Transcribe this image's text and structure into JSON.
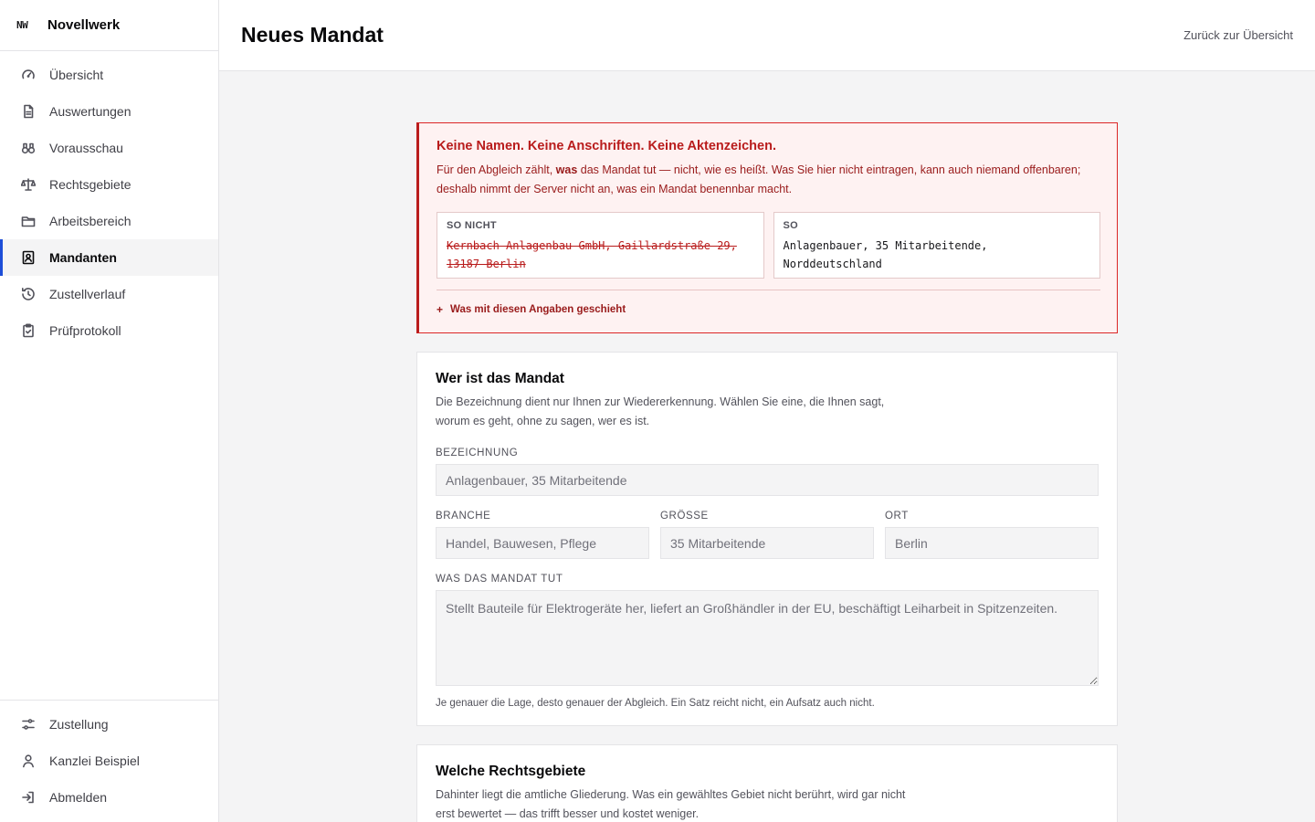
{
  "brand": {
    "mark": "NW",
    "name": "Novellwerk"
  },
  "nav": [
    {
      "label": "Übersicht",
      "icon": "gauge-icon"
    },
    {
      "label": "Auswertungen",
      "icon": "document-icon"
    },
    {
      "label": "Vorausschau",
      "icon": "binoculars-icon"
    },
    {
      "label": "Rechtsgebiete",
      "icon": "scale-icon"
    },
    {
      "label": "Arbeitsbereich",
      "icon": "folder-icon"
    },
    {
      "label": "Mandanten",
      "icon": "contact-card-icon",
      "active": true
    },
    {
      "label": "Zustellverlauf",
      "icon": "history-icon"
    },
    {
      "label": "Prüfprotokoll",
      "icon": "clipboard-check-icon"
    }
  ],
  "nav_bottom": [
    {
      "label": "Zustellung",
      "icon": "sliders-icon"
    },
    {
      "label": "Kanzlei Beispiel",
      "icon": "user-icon"
    },
    {
      "label": "Abmelden",
      "icon": "logout-icon"
    }
  ],
  "header": {
    "title": "Neues Mandat",
    "back_link": "Zurück zur Übersicht"
  },
  "warning": {
    "title": "Keine Namen. Keine Anschriften. Keine Aktenzeichen.",
    "text_pre": "Für den Abgleich zählt, ",
    "text_bold": "was",
    "text_post": " das Mandat tut — nicht, wie es heißt. Was Sie hier nicht eintragen, kann auch niemand offenbaren; deshalb nimmt der Server nicht an, was ein Mandat benennbar macht.",
    "bad_label": "SO NICHT",
    "bad_example": "Kernbach Anlagenbau GmbH, Gaillardstraße 29, 13187 Berlin",
    "good_label": "SO",
    "good_example": "Anlagenbauer, 35 Mitarbeitende, Norddeutschland",
    "details_plus": "+",
    "details_label": "Was mit diesen Angaben geschieht"
  },
  "section1": {
    "title": "Wer ist das Mandat",
    "description": "Die Bezeichnung dient nur Ihnen zur Wiedererkennung. Wählen Sie eine, die Ihnen sagt, worum es geht, ohne zu sagen, wer es ist.",
    "bezeichnung": {
      "label": "BEZEICHNUNG",
      "placeholder": "Anlagenbauer, 35 Mitarbeitende",
      "value": ""
    },
    "branche": {
      "label": "BRANCHE",
      "placeholder": "Handel, Bauwesen, Pflege",
      "value": ""
    },
    "groesse": {
      "label": "GRÖSSE",
      "placeholder": "35 Mitarbeitende",
      "value": ""
    },
    "ort": {
      "label": "ORT",
      "placeholder": "Berlin",
      "value": ""
    },
    "taetigkeit": {
      "label": "WAS DAS MANDAT TUT",
      "placeholder": "Stellt Bauteile für Elektrogeräte her, liefert an Großhändler in der EU, beschäftigt Leiharbeit in Spitzenzeiten.",
      "value": ""
    },
    "hint": "Je genauer die Lage, desto genauer der Abgleich. Ein Satz reicht nicht, ein Aufsatz auch nicht."
  },
  "section2": {
    "title": "Welche Rechtsgebiete",
    "description": "Dahinter liegt die amtliche Gliederung. Was ein gewähltes Gebiet nicht berührt, wird gar nicht erst bewertet — das trifft besser und kostet weniger."
  },
  "colors": {
    "accent": "#1d4ed8",
    "warning_border": "#dc2626",
    "warning_text": "#991b1b",
    "warning_bg": "#fef2f2"
  }
}
